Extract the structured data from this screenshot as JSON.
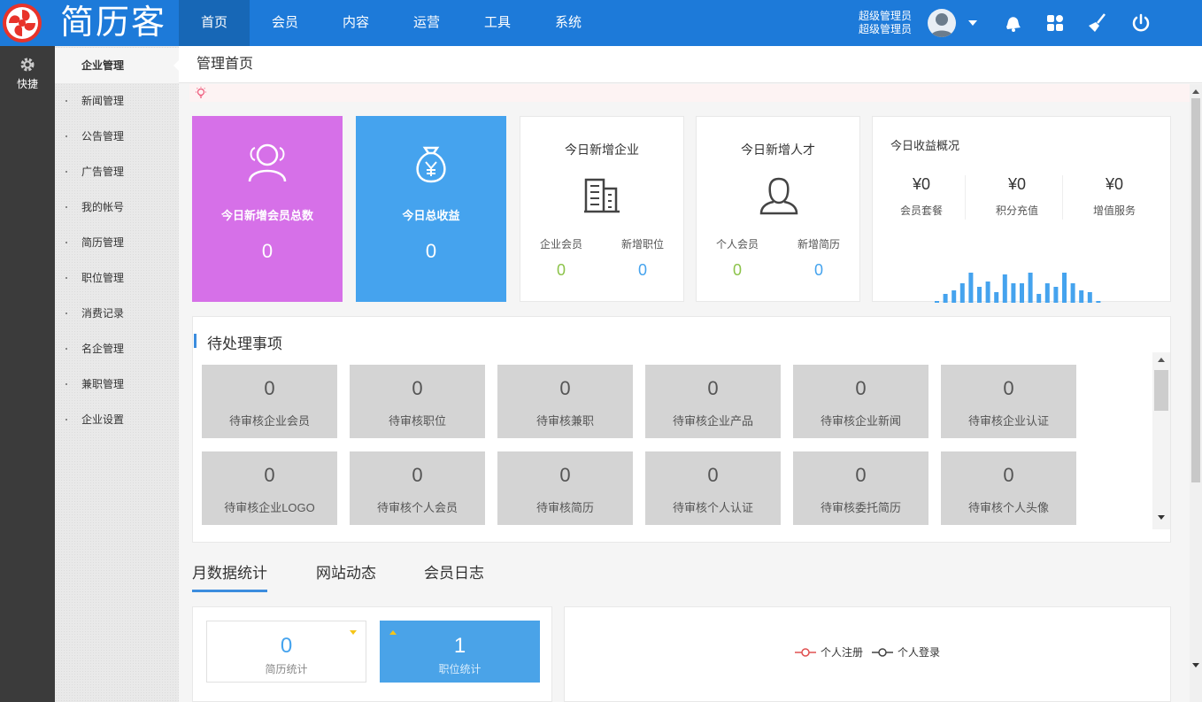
{
  "app": {
    "logo_text": "简历客"
  },
  "nav": {
    "items": [
      "首页",
      "会员",
      "内容",
      "运营",
      "工具",
      "系统"
    ],
    "active_index": 0
  },
  "user": {
    "line1": "超级管理员",
    "line2": "超级管理员"
  },
  "quick": {
    "label": "快捷"
  },
  "sidebar": {
    "items": [
      "企业管理",
      "新闻管理",
      "公告管理",
      "广告管理",
      "我的帐号",
      "简历管理",
      "职位管理",
      "消费记录",
      "名企管理",
      "兼职管理",
      "企业设置"
    ],
    "active_index": 0
  },
  "page": {
    "title": "管理首页"
  },
  "stats": {
    "new_members": {
      "label": "今日新增会员总数",
      "value": "0",
      "color": "#d670e8"
    },
    "total_revenue": {
      "label": "今日总收益",
      "value": "0",
      "color": "#45a3ee"
    }
  },
  "new_company": {
    "title": "今日新增企业",
    "left_label": "企业会员",
    "left_value": "0",
    "right_label": "新增职位",
    "right_value": "0"
  },
  "new_talent": {
    "title": "今日新增人才",
    "left_label": "个人会员",
    "left_value": "0",
    "right_label": "新增简历",
    "right_value": "0"
  },
  "revenue": {
    "title": "今日收益概况",
    "items": [
      {
        "amount": "¥0",
        "label": "会员套餐"
      },
      {
        "amount": "¥0",
        "label": "积分充值"
      },
      {
        "amount": "¥0",
        "label": "增值服务"
      }
    ]
  },
  "pending": {
    "title": "待处理事项",
    "items": [
      {
        "count": "0",
        "label": "待审核企业会员"
      },
      {
        "count": "0",
        "label": "待审核职位"
      },
      {
        "count": "0",
        "label": "待审核兼职"
      },
      {
        "count": "0",
        "label": "待审核企业产品"
      },
      {
        "count": "0",
        "label": "待审核企业新闻"
      },
      {
        "count": "0",
        "label": "待审核企业认证"
      },
      {
        "count": "0",
        "label": "待审核企业LOGO"
      },
      {
        "count": "0",
        "label": "待审核个人会员"
      },
      {
        "count": "0",
        "label": "待审核简历"
      },
      {
        "count": "0",
        "label": "待审核个人认证"
      },
      {
        "count": "0",
        "label": "待审核委托简历"
      },
      {
        "count": "0",
        "label": "待审核个人头像"
      }
    ]
  },
  "tabs": {
    "items": [
      "月数据统计",
      "网站动态",
      "会员日志"
    ],
    "active_index": 0
  },
  "monthly": {
    "resume": {
      "value": "0",
      "label": "简历统计"
    },
    "job": {
      "value": "1",
      "label": "职位统计"
    }
  },
  "chart": {
    "legend": [
      {
        "name": "个人注册",
        "color": "#e05050"
      },
      {
        "name": "个人登录",
        "color": "#444444"
      }
    ]
  },
  "colors": {
    "accent": "#1d7ad9",
    "green": "#8cc34a",
    "blue": "#45a3ee"
  }
}
